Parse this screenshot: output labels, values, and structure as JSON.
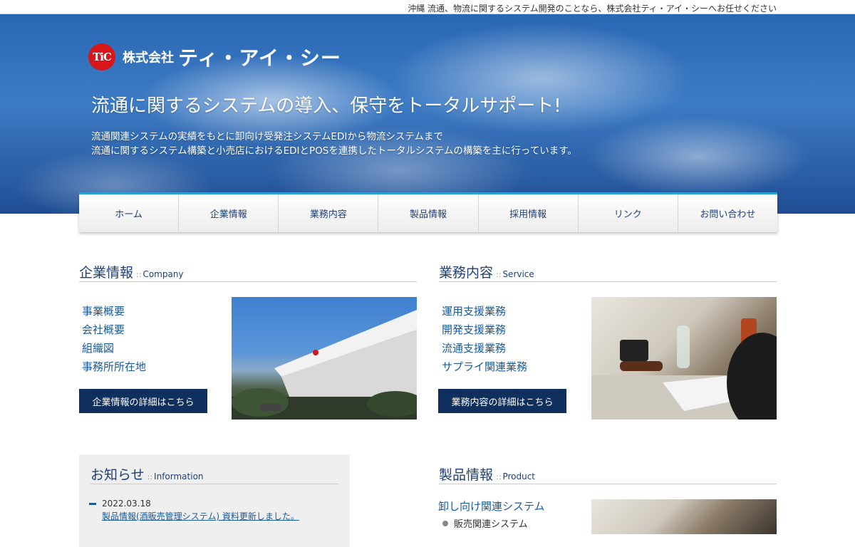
{
  "topbar": {
    "tagline": "沖縄 流通、物流に関するシステム開発のことなら、株式会社ティ・アイ・シーへお任せください"
  },
  "hero": {
    "logo_mark": "TiC",
    "logo_kaisha": "株式会社",
    "logo_name": "ティ・アイ・シー",
    "headline": "流通に関するシステムの導入、保守をトータルサポート!",
    "desc_line1": "流通関連システムの実績をもとに卸向け受発注システムEDIから物流システムまで",
    "desc_line2": "流通に関するシステム構築と小売店におけるEDIとPOSを連携したトータルシステムの構築を主に行っています。"
  },
  "nav": {
    "items": [
      {
        "label": "ホーム"
      },
      {
        "label": "企業情報"
      },
      {
        "label": "業務内容"
      },
      {
        "label": "製品情報"
      },
      {
        "label": "採用情報"
      },
      {
        "label": "リンク"
      },
      {
        "label": "お問い合わせ"
      }
    ]
  },
  "company": {
    "title_jp": "企業情報",
    "title_sep": "::",
    "title_en": "Company",
    "links": [
      "事業概要",
      "会社概要",
      "組織図",
      "事務所所在地"
    ],
    "button": "企業情報の詳細はこちら"
  },
  "service": {
    "title_jp": "業務内容",
    "title_sep": "::",
    "title_en": "Service",
    "links": [
      "運用支援業務",
      "開発支援業務",
      "流通支援業務",
      "サプライ関連業務"
    ],
    "button": "業務内容の詳細はこちら"
  },
  "information": {
    "title_jp": "お知らせ",
    "title_sep": "::",
    "title_en": "Information",
    "news": [
      {
        "date": "2022.03.18",
        "title": "製品情報(酒販売管理システム) 資料更新しました。"
      }
    ]
  },
  "product": {
    "title_jp": "製品情報",
    "title_sep": "::",
    "title_en": "Product",
    "sub_link": "卸し向け関連システム",
    "bullet": "販売関連システム"
  }
}
